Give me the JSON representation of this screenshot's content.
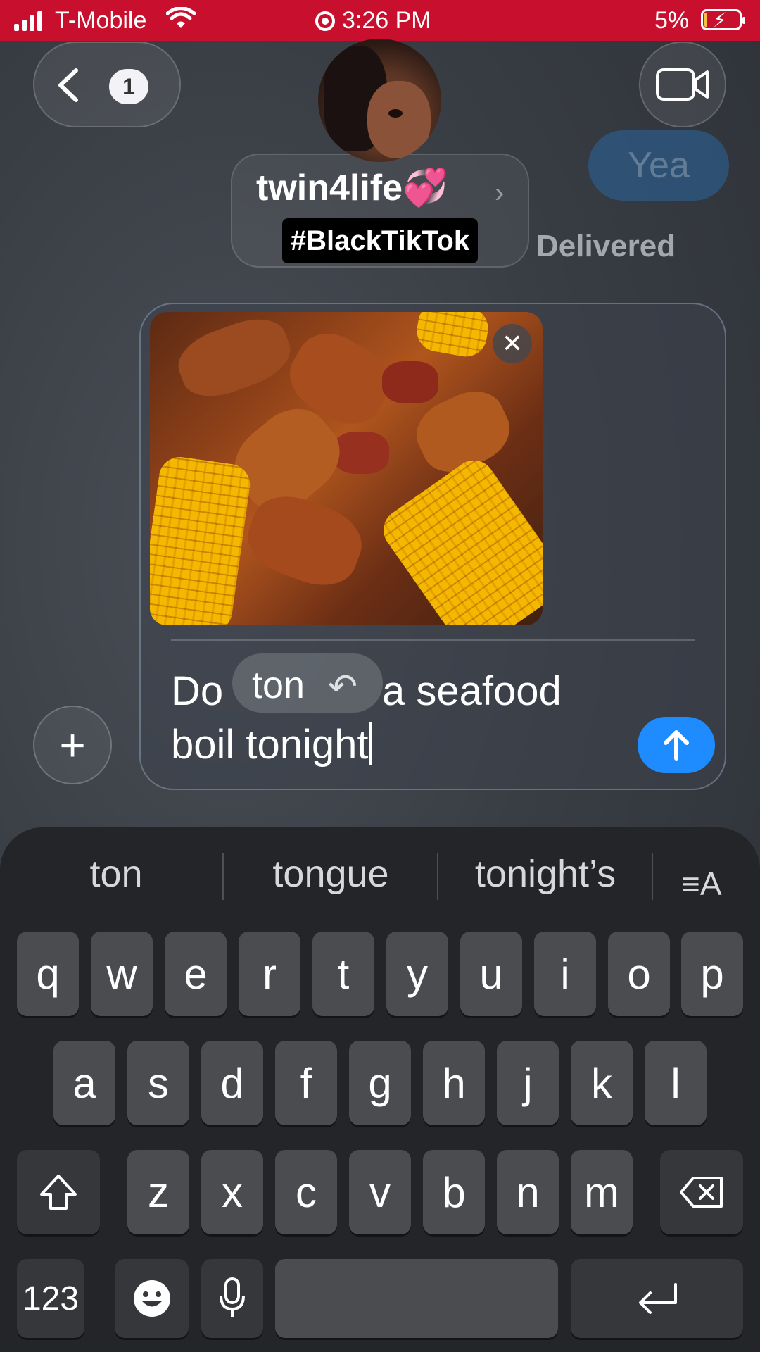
{
  "status_bar": {
    "carrier": "T-Mobile",
    "time": "3:26 PM",
    "battery_percent": "5%",
    "battery_level": 0.05,
    "background_color": "#c8102e",
    "icons": [
      "signal-icon",
      "wifi-icon",
      "screen-recording-icon",
      "battery-charging-icon"
    ]
  },
  "header": {
    "back_badge_count": "1",
    "contact_name": "twin4life💞",
    "hashtag": "#BlackTikTok",
    "icons": [
      "back-chevron-icon",
      "video-camera-icon",
      "chevron-right-icon"
    ]
  },
  "conversation": {
    "last_sent_message": "Yea",
    "delivery_status": "Delivered"
  },
  "compose": {
    "attachment": "seafood-boil-photo",
    "message_prefix": "Do",
    "message_middle": "a seafood",
    "message_line2": "boil tonight",
    "autocorrect_suggestion": "ton",
    "accent_color": "#1e8cff",
    "icons": [
      "close-icon",
      "undo-icon",
      "send-arrow-icon",
      "plus-icon"
    ]
  },
  "keyboard": {
    "suggestions": [
      "ton",
      "tongue",
      "tonight’s"
    ],
    "format_icon": "≡A",
    "rows": [
      [
        "q",
        "w",
        "e",
        "r",
        "t",
        "y",
        "u",
        "i",
        "o",
        "p"
      ],
      [
        "a",
        "s",
        "d",
        "f",
        "g",
        "h",
        "j",
        "k",
        "l"
      ],
      [
        "z",
        "x",
        "c",
        "v",
        "b",
        "n",
        "m"
      ]
    ],
    "numbers_key": "123",
    "icons": [
      "shift-icon",
      "delete-icon",
      "emoji-icon",
      "microphone-icon",
      "return-icon"
    ]
  }
}
